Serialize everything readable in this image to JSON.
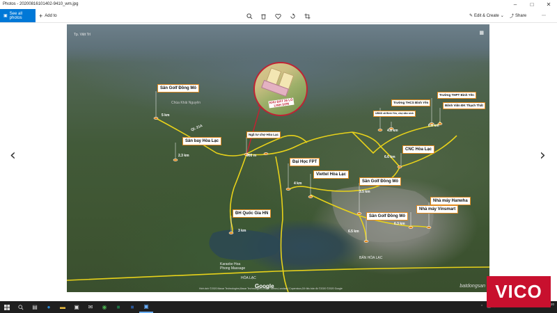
{
  "window": {
    "title": "Photos - 20200816101402-9410_wm.jpg",
    "controls": [
      "minimize",
      "maximize",
      "close"
    ]
  },
  "toolbar": {
    "see_all_photos": "See all photos",
    "add_to": "Add to",
    "tools": [
      "zoom-icon",
      "delete-icon",
      "heart-icon",
      "rotate-icon",
      "crop-icon"
    ],
    "edit_create": "Edit & Create",
    "share": "Share",
    "more": "⋯"
  },
  "photo": {
    "corner_label": "Tp. Việt Trì",
    "zoom_caption": "KHU ĐẤT 26 LÔ LINH SƠN",
    "labels": {
      "san_golf_top": "Sân Golf Đồng Mô",
      "san_bay": "Sân bay Hòa Lạc",
      "nga_tu": "Ngã tư chợ Hòa Lạc",
      "dai_hoc_fpt": "Đại Học FPT",
      "viettel": "Viettel Hòa Lạc",
      "san_golf_mid": "Sân Golf Đồng Mô",
      "dh_quoc_gia": "ĐH Quốc Gia HN",
      "san_golf_low": "Sân Golf Đồng Mô",
      "nha_may_vinsmart": "Nhà máy Vinsmart",
      "nha_may_hanwha": "Nhà máy Hanwha",
      "cnc": "CNC Hòa Lạc",
      "truong_thcs": "Trường THCS Bình Yên",
      "truong_thpt": "Trường THPT Bình Yên",
      "benh_vien": "Bệnh Viện ĐK Thạch Thất",
      "ubnd": "UBND xã Bình Yên, chợ dân sinh"
    },
    "distances": {
      "d1": "5 km",
      "d2": "2.3 km",
      "d3": "900 m",
      "d4": "4 km",
      "d5": "3.5 km",
      "d6": "3 km",
      "d7": "6.5 km",
      "d8": "6.3 km",
      "d9": "6.8 km",
      "d10": "4.8 km",
      "d11": "6.6 km"
    },
    "map_labels": {
      "ql21a": "QL 21A",
      "chua_kim": "Chùa Khải Nguyên",
      "karaoke": "Karaoke Hoa\nPhong Massage",
      "hoa_lac": "HÒA LẠC",
      "ban_hoa_lac": "BẢN HÒA LẠC",
      "google": "Google",
      "batdongsan": "batdongsan",
      "credit": "Hình ảnh ©2020 Maxar Technologies,Maxar Technologies,CNES / Airbus,Landsat / Copernicus,Dữ liệu bản đồ ©2020 ©2020 Google"
    }
  },
  "taskbar": {
    "icons": [
      "windows-icon",
      "search-icon",
      "taskview-icon",
      "edge-icon",
      "explorer-icon",
      "store-icon",
      "mail-icon",
      "chrome-icon",
      "excel-icon",
      "word-icon",
      "photos-icon"
    ],
    "lang": "ENG",
    "time": "",
    "date": "8/20/2020"
  },
  "watermark": {
    "brand": "VICO"
  },
  "colors": {
    "accent": "#0078d7",
    "route": "#e8d21a",
    "marker": "#e28a1e",
    "brand": "#c8102e"
  }
}
